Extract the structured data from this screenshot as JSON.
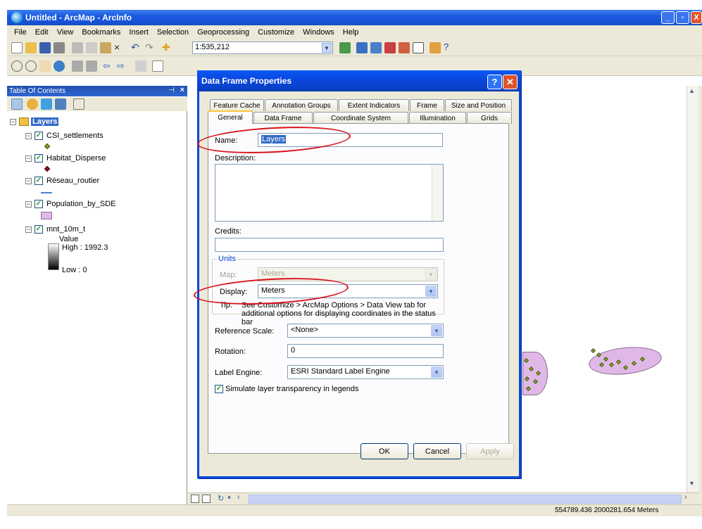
{
  "window": {
    "title": "Untitled - ArcMap - ArcInfo",
    "buttons": {
      "minimize": "_",
      "maximize": "▫",
      "close": "X"
    }
  },
  "menu": [
    "File",
    "Edit",
    "View",
    "Bookmarks",
    "Insert",
    "Selection",
    "Geoprocessing",
    "Customize",
    "Windows",
    "Help"
  ],
  "toolbar": {
    "scale": "1:535,212"
  },
  "toc": {
    "title": "Table Of Contents",
    "root": "Layers",
    "layers": [
      {
        "name": "CSI_settlements"
      },
      {
        "name": "Habitat_Disperse"
      },
      {
        "name": "Réseau_routier"
      },
      {
        "name": "Population_by_SDE"
      },
      {
        "name": "mnt_10m_t"
      }
    ],
    "raster_legend": {
      "value_label": "Value",
      "high": "High : 1992.3",
      "low": "Low : 0"
    }
  },
  "dialog": {
    "title": "Data Frame Properties",
    "tabs_row1": [
      "Feature Cache",
      "Annotation Groups",
      "Extent Indicators",
      "Frame",
      "Size and Position"
    ],
    "tabs_row2": [
      "General",
      "Data Frame",
      "Coordinate System",
      "Illumination",
      "Grids"
    ],
    "active_tab": "General",
    "name_label": "Name:",
    "name_value": "Layers",
    "description_label": "Description:",
    "credits_label": "Credits:",
    "units_group": "Units",
    "map_label": "Map:",
    "map_value": "Meters",
    "display_label": "Display:",
    "display_value": "Meters",
    "tip_label": "Tip:",
    "tip_text": "See Customize > ArcMap Options > Data View tab for additional options for displaying coordinates in the status bar",
    "reference_scale_label": "Reference Scale:",
    "reference_scale_value": "<None>",
    "rotation_label": "Rotation:",
    "rotation_value": "0",
    "label_engine_label": "Label Engine:",
    "label_engine_value": "ESRI Standard Label Engine",
    "simulate_label": "Simulate layer transparency in legends",
    "ok": "OK",
    "cancel": "Cancel",
    "apply": "Apply"
  },
  "status": {
    "coordinates": "554789.436  2000281.654 Meters"
  },
  "colors": {
    "titlebar": "#1552d6",
    "highlight_ellipse": "#d8101a",
    "polygon_fill": "#e0b8e8",
    "settlement_point": "#8aa030"
  }
}
